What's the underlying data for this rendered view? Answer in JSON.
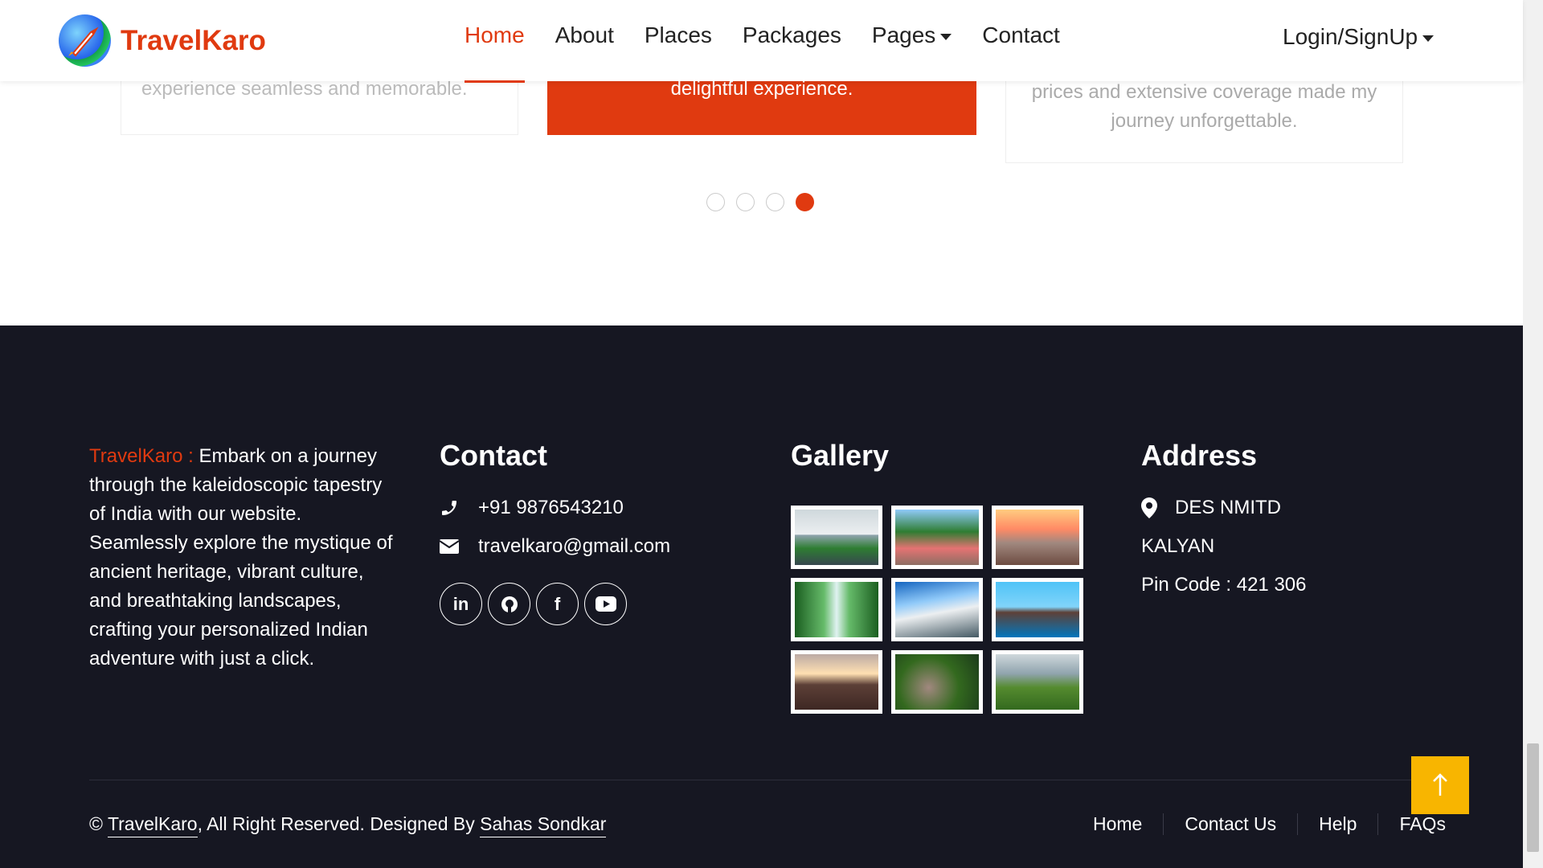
{
  "brand": {
    "name": "TravelKaro"
  },
  "nav": {
    "items": [
      {
        "label": "Home",
        "active": true
      },
      {
        "label": "About"
      },
      {
        "label": "Places"
      },
      {
        "label": "Packages"
      },
      {
        "label": "Pages",
        "dropdown": true
      },
      {
        "label": "Contact"
      }
    ],
    "login_label": "Login/SignUp"
  },
  "testimonials": {
    "left_text": "experience seamless and memorable.",
    "middle_text": "delightful experience.",
    "right_line1": "prices and extensive coverage made my",
    "right_line2": "journey unforgettable.",
    "dots_count": 4,
    "active_dot": 4
  },
  "footer": {
    "about_brand": "TravelKaro : ",
    "about_text": "Embark on a journey through the kaleidoscopic tapestry of India with our website. Seamlessly explore the mystique of ancient heritage, vibrant culture, and breathtaking landscapes, crafting your personalized Indian adventure with just a click.",
    "contact": {
      "title": "Contact",
      "phone": "+91 9876543210",
      "email": "travelkaro@gmail.com",
      "socials": [
        "linkedin-icon",
        "github-icon",
        "facebook-icon",
        "youtube-icon"
      ]
    },
    "gallery": {
      "title": "Gallery",
      "images": [
        "taj-mahal",
        "village-palms",
        "city-sunset",
        "waterfall",
        "snow-mountain",
        "houseboat",
        "coastal-road",
        "aerial-village",
        "mountain-ruins"
      ]
    },
    "address": {
      "title": "Address",
      "line1": "DES NMITD",
      "line2": "KALYAN",
      "line3": "Pin Code : 421 306"
    },
    "copyright_prefix": "©",
    "copyright_brand": "TravelKaro",
    "copyright_mid": ", All Right Reserved. Designed By",
    "copyright_author": "Sahas Sondkar",
    "links": [
      "Home",
      "Contact Us",
      "Help",
      "FAQs"
    ]
  },
  "colors": {
    "accent": "#e03a10",
    "footer_bg": "#161722",
    "top_button": "#f8b500"
  }
}
